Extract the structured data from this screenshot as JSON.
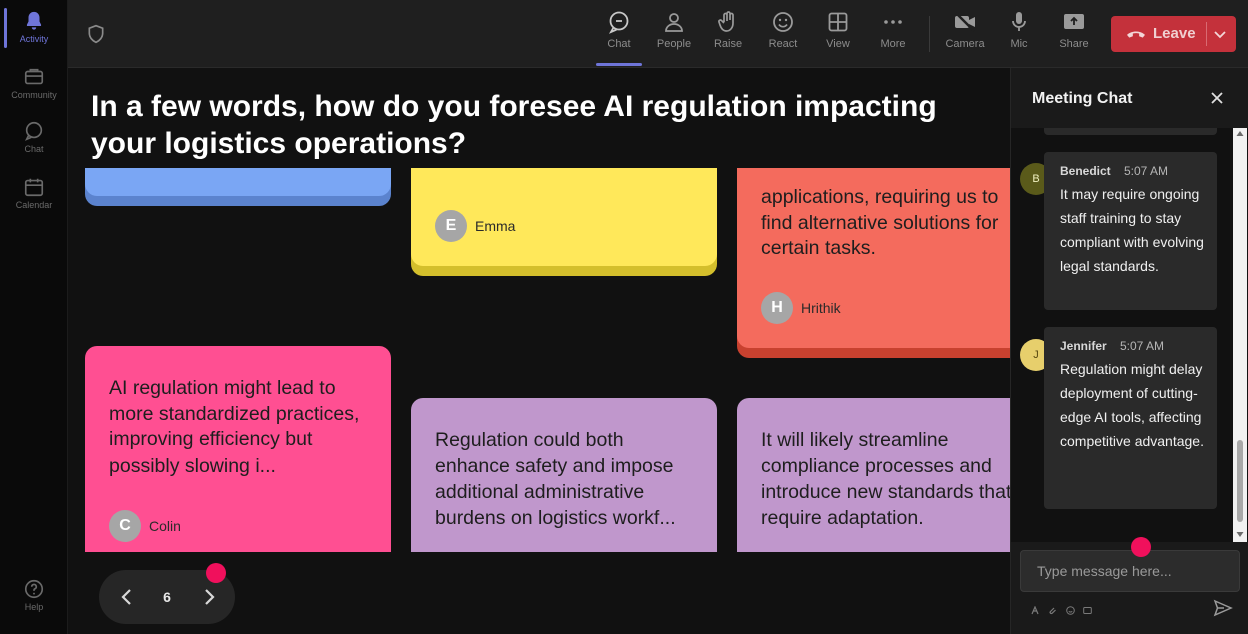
{
  "rail": {
    "items": [
      {
        "label": "Activity",
        "icon": "bell-icon",
        "active": true
      },
      {
        "label": "Community",
        "icon": "community-icon",
        "active": false
      },
      {
        "label": "Chat",
        "icon": "chat-icon",
        "active": false
      },
      {
        "label": "Calendar",
        "icon": "calendar-icon",
        "active": false
      }
    ],
    "help_label": "Help"
  },
  "toolbar": {
    "tools": [
      {
        "label": "Chat",
        "icon": "chat-icon"
      },
      {
        "label": "People",
        "icon": "people-icon"
      },
      {
        "label": "Raise",
        "icon": "hand-icon"
      },
      {
        "label": "React",
        "icon": "smiley-icon"
      },
      {
        "label": "View",
        "icon": "grid-icon"
      },
      {
        "label": "More",
        "icon": "more-icon"
      },
      {
        "label": "Camera",
        "icon": "camera-off-icon"
      },
      {
        "label": "Mic",
        "icon": "mic-icon"
      },
      {
        "label": "Share",
        "icon": "share-icon"
      }
    ],
    "leave_label": "Leave",
    "colors": {
      "accent": "#6f75d9",
      "leave": "#c4313b"
    }
  },
  "board": {
    "question_line1": "In a few words, how do you foresee AI regulation impacting",
    "question_line2": "your logistics operations?",
    "cards": [
      {
        "color": "#f46b5d",
        "lines": [
          "applications, requiring us to",
          "find alternative solutions for",
          "certain tasks."
        ],
        "initial": "H",
        "author": "Hrithik"
      },
      {
        "color": "#ffe85a",
        "lines": [],
        "initial": "E",
        "author": "Emma"
      },
      {
        "color": "#ff4f92",
        "lines": [
          "AI regulation might lead to",
          "more standardized practices,",
          "improving efficiency but",
          "possibly slowing i..."
        ],
        "initial": "C",
        "author": "Colin"
      },
      {
        "color": "#c097cc",
        "lines": [
          "Regulation could both",
          "enhance safety and impose",
          "additional administrative",
          "burdens on logistics workf..."
        ],
        "initial": "",
        "author": ""
      },
      {
        "color": "#c097cc",
        "lines": [
          "It will likely streamline",
          "compliance processes and",
          "introduce new standards that",
          "require adaptation."
        ],
        "initial": "",
        "author": ""
      }
    ],
    "page_number": "6"
  },
  "chat": {
    "title": "Meeting Chat",
    "messages": [
      {
        "initial": "B",
        "name": "Benedict",
        "time": "5:07 AM",
        "text": "It may require ongoing staff training to stay compliant with evolving legal standards.",
        "avatar_bg": "#5a5a1a",
        "avatar_fg": "#f0f0c0"
      },
      {
        "initial": "J",
        "name": "Jennifer",
        "time": "5:07 AM",
        "text": "Regulation might delay deployment of cutting-edge AI tools, affecting competitive advantage.",
        "avatar_bg": "#e7cf6c",
        "avatar_fg": "#5a4a10"
      }
    ],
    "compose_placeholder": "Type message here...",
    "highlight_color": "#f0105c"
  }
}
